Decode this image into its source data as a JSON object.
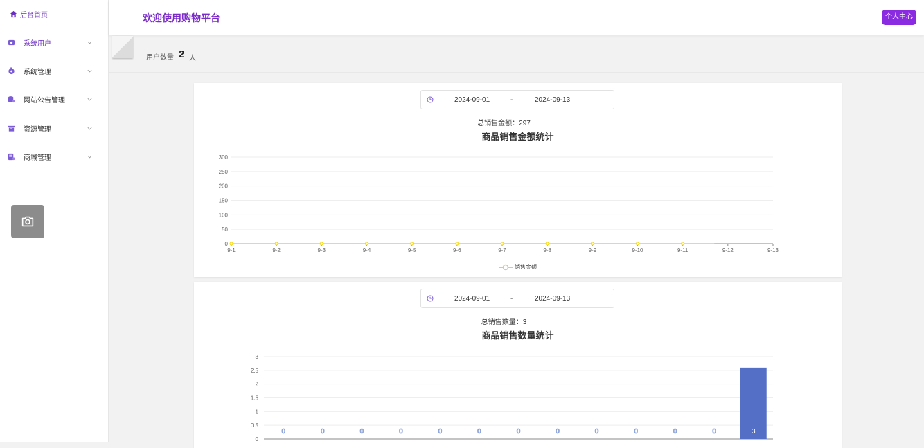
{
  "sidebar": {
    "home_label": "后台首页",
    "items": [
      {
        "label": "系统用户",
        "icon": "user-icon",
        "active": true
      },
      {
        "label": "系统管理",
        "icon": "system-icon"
      },
      {
        "label": "网站公告管理",
        "icon": "notice-icon"
      },
      {
        "label": "资源管理",
        "icon": "resource-icon"
      },
      {
        "label": "商城管理",
        "icon": "mall-icon"
      }
    ],
    "camera_icon": "camera-icon"
  },
  "header": {
    "title": "欢迎使用购物平台",
    "user_center": "个人中心"
  },
  "stats": {
    "label": "用户数量",
    "value": "2",
    "unit": "人"
  },
  "sales_amount": {
    "start_date": "2024-09-01",
    "separator": "-",
    "end_date": "2024-09-13",
    "summary_label": "总销售金额：",
    "summary_value": "297",
    "title": "商品销售金额统计",
    "legend": "销售金额"
  },
  "sales_count": {
    "start_date": "2024-09-01",
    "separator": "-",
    "end_date": "2024-09-13",
    "summary_label": "总销售数量：",
    "summary_value": "3",
    "title": "商品销售数量统计"
  },
  "colors": {
    "accent": "#7a2bc8",
    "button": "#8a2be2",
    "line_series": "#f5d40a",
    "bar_series": "#5470c6"
  },
  "chart_data": [
    {
      "type": "line",
      "title": "商品销售金额统计",
      "x": [
        "9-1",
        "9-2",
        "9-3",
        "9-4",
        "9-5",
        "9-6",
        "9-7",
        "9-8",
        "9-9",
        "9-10",
        "9-11",
        "9-12",
        "9-13"
      ],
      "series": [
        {
          "name": "销售金额",
          "values": [
            0,
            0,
            0,
            0,
            0,
            0,
            0,
            0,
            0,
            0,
            0,
            null,
            null
          ]
        }
      ],
      "yticks": [
        0,
        50,
        100,
        150,
        200,
        250,
        300
      ],
      "ylim": [
        0,
        300
      ],
      "grid": true,
      "legend": "bottom"
    },
    {
      "type": "bar",
      "title": "商品销售数量统计",
      "values": [
        0,
        0,
        0,
        0,
        0,
        0,
        0,
        0,
        0,
        0,
        0,
        0,
        2.6
      ],
      "labels": [
        "0",
        "0",
        "0",
        "0",
        "0",
        "0",
        "0",
        "0",
        "0",
        "0",
        "0",
        "0",
        "3"
      ],
      "yticks": [
        "0",
        "0.5",
        "1",
        "1.5",
        "2",
        "2.5",
        "3"
      ],
      "ylim": [
        0,
        3
      ],
      "grid": true
    }
  ]
}
